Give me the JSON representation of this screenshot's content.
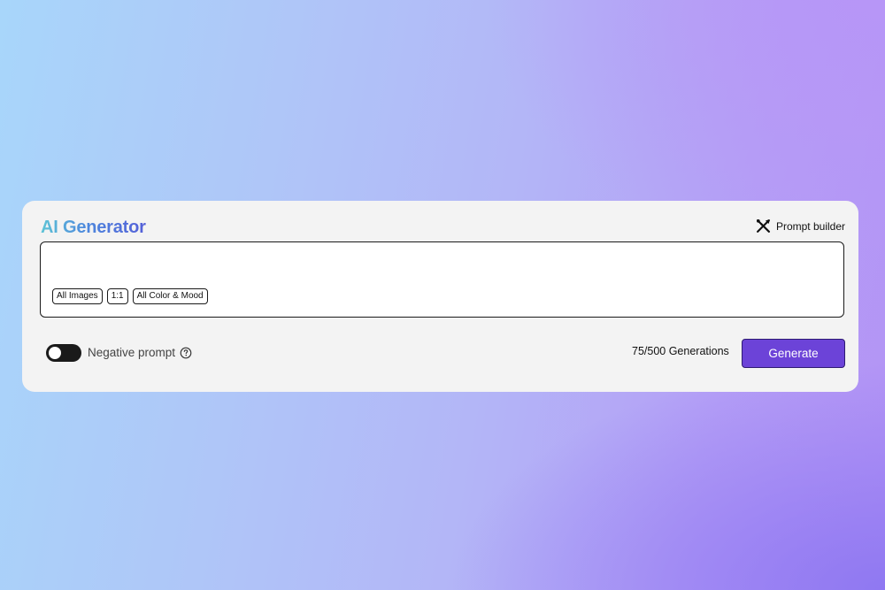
{
  "generator": {
    "title": "AI Generator",
    "prompt_builder_label": "Prompt builder",
    "prompt": {
      "value": "",
      "placeholder": ""
    },
    "chips": [
      {
        "label": "All Images"
      },
      {
        "label": "1:1"
      },
      {
        "label": "All Color & Mood"
      }
    ],
    "negative_prompt": {
      "label": "Negative prompt",
      "enabled": false
    },
    "generations_label": "75/500 Generations",
    "generate_label": "Generate"
  },
  "icons": {
    "prompt_builder": "tools-icon",
    "help": "question-circle-icon"
  },
  "colors": {
    "accent": "#6c43d8",
    "card_background": "#f3f3f3",
    "title_gradient": [
      "#5ec4d6",
      "#4d86dd",
      "#5560d8"
    ]
  }
}
